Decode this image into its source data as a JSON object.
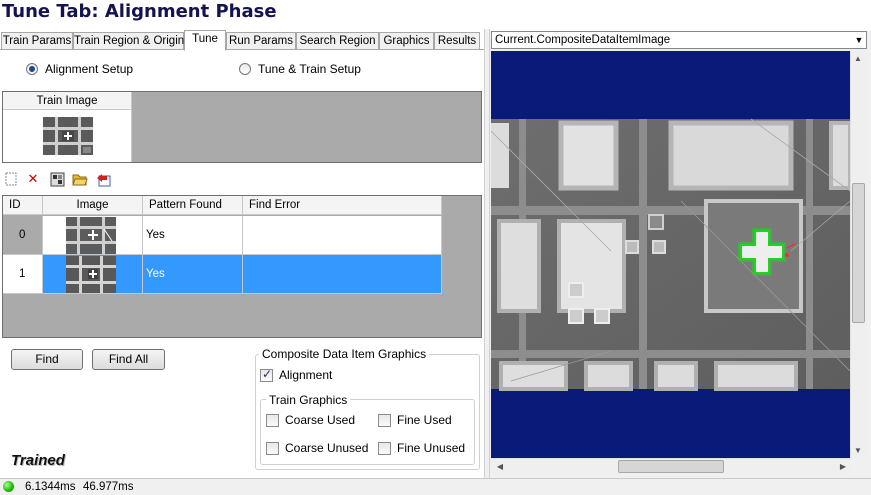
{
  "window_title": "Tune Tab: Alignment Phase",
  "tabs": [
    {
      "label": "Train Params"
    },
    {
      "label": "Train Region & Origin"
    },
    {
      "label": "Tune"
    },
    {
      "label": "Run Params"
    },
    {
      "label": "Search Region"
    },
    {
      "label": "Graphics"
    },
    {
      "label": "Results"
    }
  ],
  "active_tab": "Tune",
  "mode": {
    "options": [
      "Alignment Setup",
      "Tune & Train Setup"
    ],
    "selected": "Alignment Setup"
  },
  "train_image_grid": {
    "header": "Train Image"
  },
  "toolbar": {
    "icons": [
      "new-icon",
      "delete-icon",
      "grid-icon",
      "open-folder-icon",
      "import-icon"
    ]
  },
  "results_grid": {
    "columns": [
      "ID",
      "Image",
      "Pattern Found",
      "Find Error"
    ],
    "rows": [
      {
        "id": "0",
        "pattern_found": "Yes",
        "find_error": "",
        "selected": false
      },
      {
        "id": "1",
        "pattern_found": "Yes",
        "find_error": "",
        "selected": true
      }
    ]
  },
  "buttons": {
    "find": "Find",
    "find_all": "Find All"
  },
  "composite_graphics": {
    "title": "Composite Data Item Graphics",
    "alignment": {
      "label": "Alignment",
      "checked": true
    },
    "train_graphics": {
      "title": "Train Graphics",
      "options": [
        {
          "label": "Coarse Used",
          "checked": false
        },
        {
          "label": "Fine Used",
          "checked": false
        },
        {
          "label": "Coarse Unused",
          "checked": false
        },
        {
          "label": "Fine Unused",
          "checked": false
        }
      ]
    }
  },
  "status_label": "Trained",
  "image_selector": {
    "value": "Current.CompositeDataItemImage"
  },
  "statusbar": {
    "time1": "6.1344ms",
    "time2": "46.977ms",
    "status_color": "#1bb800"
  },
  "colors": {
    "title": "#13144f",
    "selection": "#3399ff",
    "viewer_background": "#0a1a78"
  }
}
